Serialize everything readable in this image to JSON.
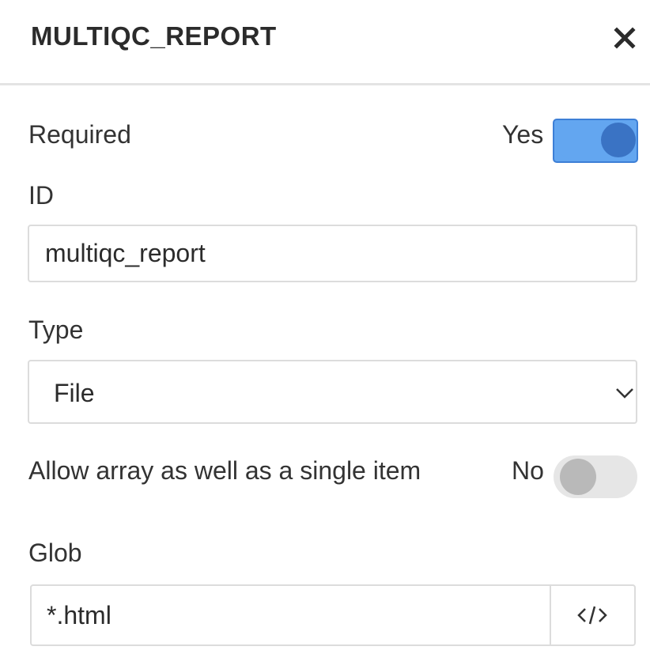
{
  "header": {
    "title": "MULTIQC_REPORT",
    "close_icon": "close-icon"
  },
  "required": {
    "label": "Required",
    "state_text": "Yes",
    "on": true
  },
  "id_field": {
    "label": "ID",
    "value": "multiqc_report"
  },
  "type_field": {
    "label": "Type",
    "selected": "File",
    "icon": "chevron-down-icon"
  },
  "array_toggle": {
    "label": "Allow array as well as a single item",
    "state_text": "No",
    "on": false
  },
  "glob_field": {
    "label": "Glob",
    "value": "*.html",
    "button_icon": "code-icon"
  },
  "colors": {
    "toggle_on_track": "#63a6f0",
    "toggle_on_knob": "#3a73c4",
    "toggle_off_track": "#e6e6e6",
    "toggle_off_knob": "#b9b9b9",
    "border": "#dcdcdc"
  }
}
